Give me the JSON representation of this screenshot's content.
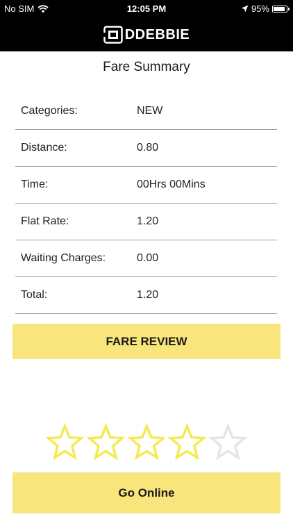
{
  "status_bar": {
    "carrier": "No SIM",
    "time": "12:05 PM",
    "battery_percent": "95%",
    "battery_level": 0.95
  },
  "header": {
    "logo_text": "DDEBBIE"
  },
  "page": {
    "title": "Fare Summary"
  },
  "fare_rows": [
    {
      "label": "Categories:",
      "value": "NEW"
    },
    {
      "label": "Distance:",
      "value": "0.80"
    },
    {
      "label": "Time:",
      "value": "00Hrs 00Mins"
    },
    {
      "label": "Flat Rate:",
      "value": "1.20"
    },
    {
      "label": "Waiting Charges:",
      "value": "0.00"
    },
    {
      "label": "Total:",
      "value": "1.20"
    }
  ],
  "buttons": {
    "fare_review": "FARE REVIEW",
    "go_online": "Go Online"
  },
  "rating": {
    "value": 4,
    "max": 5,
    "filled_color": "#f5ea52",
    "empty_color": "#e5e5e5"
  },
  "colors": {
    "accent": "#f8e57b",
    "header_bg": "#000000"
  }
}
